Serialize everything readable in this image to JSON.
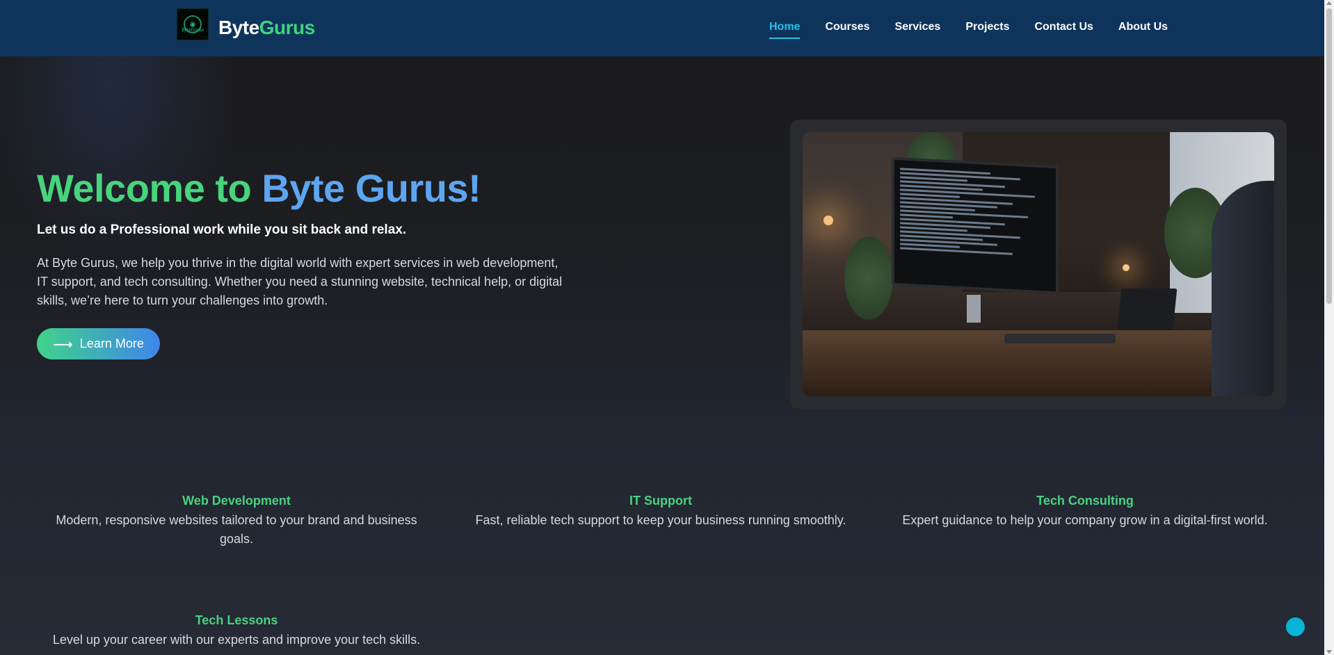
{
  "header": {
    "brand_part1": "Byte",
    "brand_part2": "Gurus",
    "logo_icon": "byte-gurus-logo",
    "nav": [
      {
        "label": "Home",
        "active": true
      },
      {
        "label": "Courses",
        "active": false
      },
      {
        "label": "Services",
        "active": false
      },
      {
        "label": "Projects",
        "active": false
      },
      {
        "label": "Contact Us",
        "active": false
      },
      {
        "label": "About Us",
        "active": false
      }
    ]
  },
  "hero": {
    "title_part1": "Welcome to",
    "title_part2": "Byte Gurus!",
    "subtitle": "Let us do a Professional work while you sit back and relax.",
    "description": "At Byte Gurus, we help you thrive in the digital world with expert services in web development, IT support, and tech consulting. Whether you need a stunning website, technical help, or digital skills, we’re here to turn your challenges into growth.",
    "cta_label": "Learn More",
    "cta_icon": "arrow-right-icon"
  },
  "services": [
    {
      "title": "Web Development",
      "description": "Modern, responsive websites tailored to your brand and business goals."
    },
    {
      "title": "IT Support",
      "description": "Fast, reliable tech support to keep your business running smoothly."
    },
    {
      "title": "Tech Consulting",
      "description": "Expert guidance to help your company grow in a digital-first world."
    },
    {
      "title": "Tech Lessons",
      "description": "Level up your career with our experts and improve your tech skills."
    }
  ],
  "colors": {
    "navbar": "#0f345c",
    "accent_green": "#48d47c",
    "accent_blue": "#5ea5f0",
    "active_nav": "#22c3e6",
    "chat_bubble": "#07b4d6"
  }
}
